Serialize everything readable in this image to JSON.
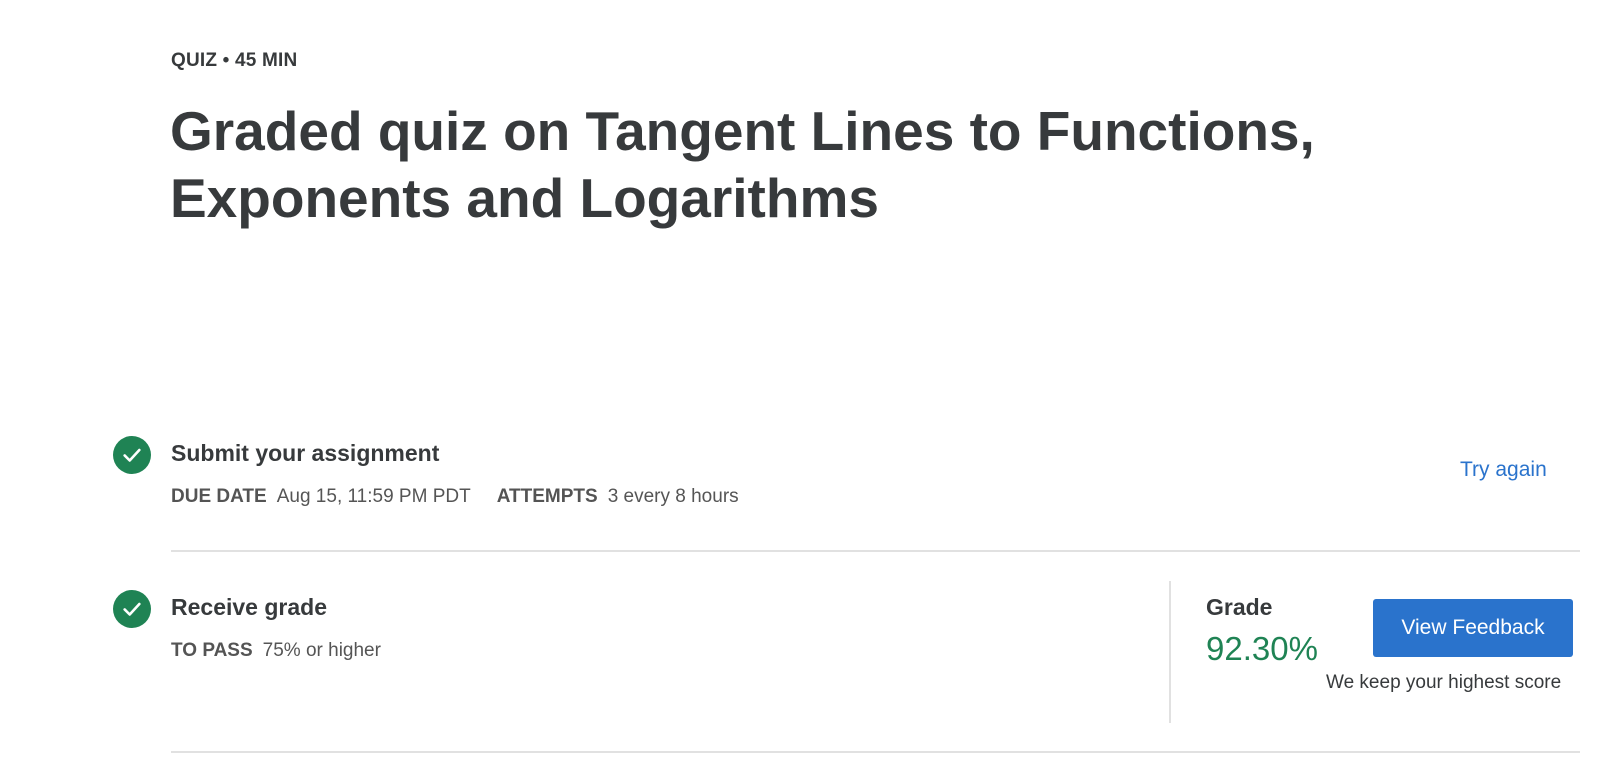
{
  "header": {
    "eyebrow": "QUIZ • 45 MIN",
    "title": "Graded quiz on Tangent Lines to Functions, Exponents and Logarithms"
  },
  "submit_step": {
    "title": "Submit your assignment",
    "due_date_label": "DUE DATE",
    "due_date_value": "Aug 15, 11:59 PM PDT",
    "attempts_label": "ATTEMPTS",
    "attempts_value": "3 every 8 hours",
    "try_again_label": "Try again",
    "icon": "check-circle-icon"
  },
  "grade_step": {
    "title": "Receive grade",
    "to_pass_label": "TO PASS",
    "to_pass_value": "75% or higher",
    "grade_label": "Grade",
    "grade_value": "92.30%",
    "view_feedback_label": "View Feedback",
    "keep_note": "We keep your highest score",
    "icon": "check-circle-icon"
  },
  "colors": {
    "success_green": "#1f8354",
    "link_blue": "#2a73cc",
    "text_dark": "#373a3c",
    "divider": "#e1e1e1"
  }
}
